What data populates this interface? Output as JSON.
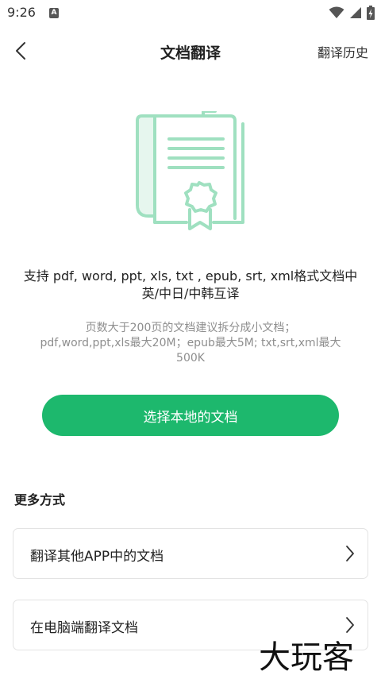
{
  "status_bar": {
    "time": "9:26",
    "app_icon_letter": "A",
    "icons": [
      "wifi-icon",
      "cell-signal-icon",
      "battery-icon"
    ]
  },
  "nav": {
    "back_icon": "chevron-left-icon",
    "title": "文档翻译",
    "history_label": "翻译历史"
  },
  "illustration": {
    "icon": "certified-document-icon",
    "color": "#9fe0c0"
  },
  "support": {
    "line1": "支持 pdf, word, ppt, xls, txt , epub, srt, xml格式文档中",
    "line2": "英/中日/中韩互译"
  },
  "limits": {
    "line1": "页数大于200页的文档建议拆分成小文档；",
    "line2": "pdf,word,ppt,xls最大20M；epub最大5M; txt,srt,xml最大",
    "line3": "500K"
  },
  "primary_action": {
    "label": "选择本地的文档",
    "color": "#1db86d"
  },
  "more": {
    "title": "更多方式",
    "options": [
      {
        "label": "翻译其他APP中的文档",
        "icon": "chevron-right-icon"
      },
      {
        "label": "在电脑端翻译文档",
        "icon": "chevron-right-icon"
      }
    ]
  },
  "watermark": "大玩客"
}
